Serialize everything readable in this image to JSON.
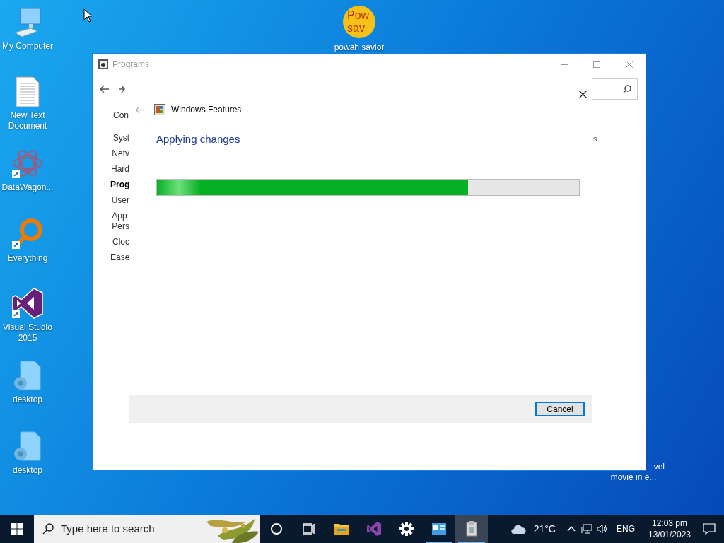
{
  "desktop_icons": [
    {
      "label": "My Computer",
      "kind": "computer"
    },
    {
      "label": "New Text Document",
      "kind": "text"
    },
    {
      "label": "DataWagon...",
      "kind": "molecule"
    },
    {
      "label": "Everything",
      "kind": "search"
    },
    {
      "label": "Visual Studio 2015",
      "kind": "vs"
    },
    {
      "label": "desktop",
      "kind": "config"
    },
    {
      "label": "desktop",
      "kind": "config"
    }
  ],
  "top_icon": {
    "label": "powah savior",
    "logo_lines": [
      "Pow",
      "sav"
    ]
  },
  "hidden_icon": {
    "lines": [
      "vel",
      "movie in e..."
    ]
  },
  "programs_window": {
    "title": "Programs",
    "sidebar": [
      {
        "label": "Con",
        "selected": false
      },
      {
        "label": "Syst",
        "selected": false
      },
      {
        "label": "Netv",
        "selected": false
      },
      {
        "label": "Hard",
        "selected": false
      },
      {
        "label": "Prog",
        "selected": true
      },
      {
        "label": "User",
        "selected": false
      },
      {
        "label": "App\nPers",
        "selected": false
      },
      {
        "label": "Cloc",
        "selected": false
      },
      {
        "label": "Ease",
        "selected": false
      }
    ],
    "fragment": "s"
  },
  "dialog": {
    "title": "Windows Features",
    "heading": "Applying changes",
    "progress": {
      "level": 0.737
    },
    "buttons": [
      "Cancel"
    ]
  },
  "taskbar": {
    "search": {
      "placeholder": "Type here to search"
    },
    "apps": [
      {
        "kind": "cortana",
        "running": false,
        "active": false
      },
      {
        "kind": "taskview",
        "running": false,
        "active": false
      },
      {
        "kind": "explorer",
        "running": false,
        "active": false
      },
      {
        "kind": "vs",
        "running": false,
        "active": false
      },
      {
        "kind": "settings",
        "running": false,
        "active": false
      },
      {
        "kind": "control",
        "running": true,
        "active": false
      },
      {
        "kind": "features",
        "running": true,
        "active": true
      }
    ],
    "weather": "21°C",
    "language": "ENG",
    "time": "12:03 pm",
    "date": "13/01/2023"
  }
}
